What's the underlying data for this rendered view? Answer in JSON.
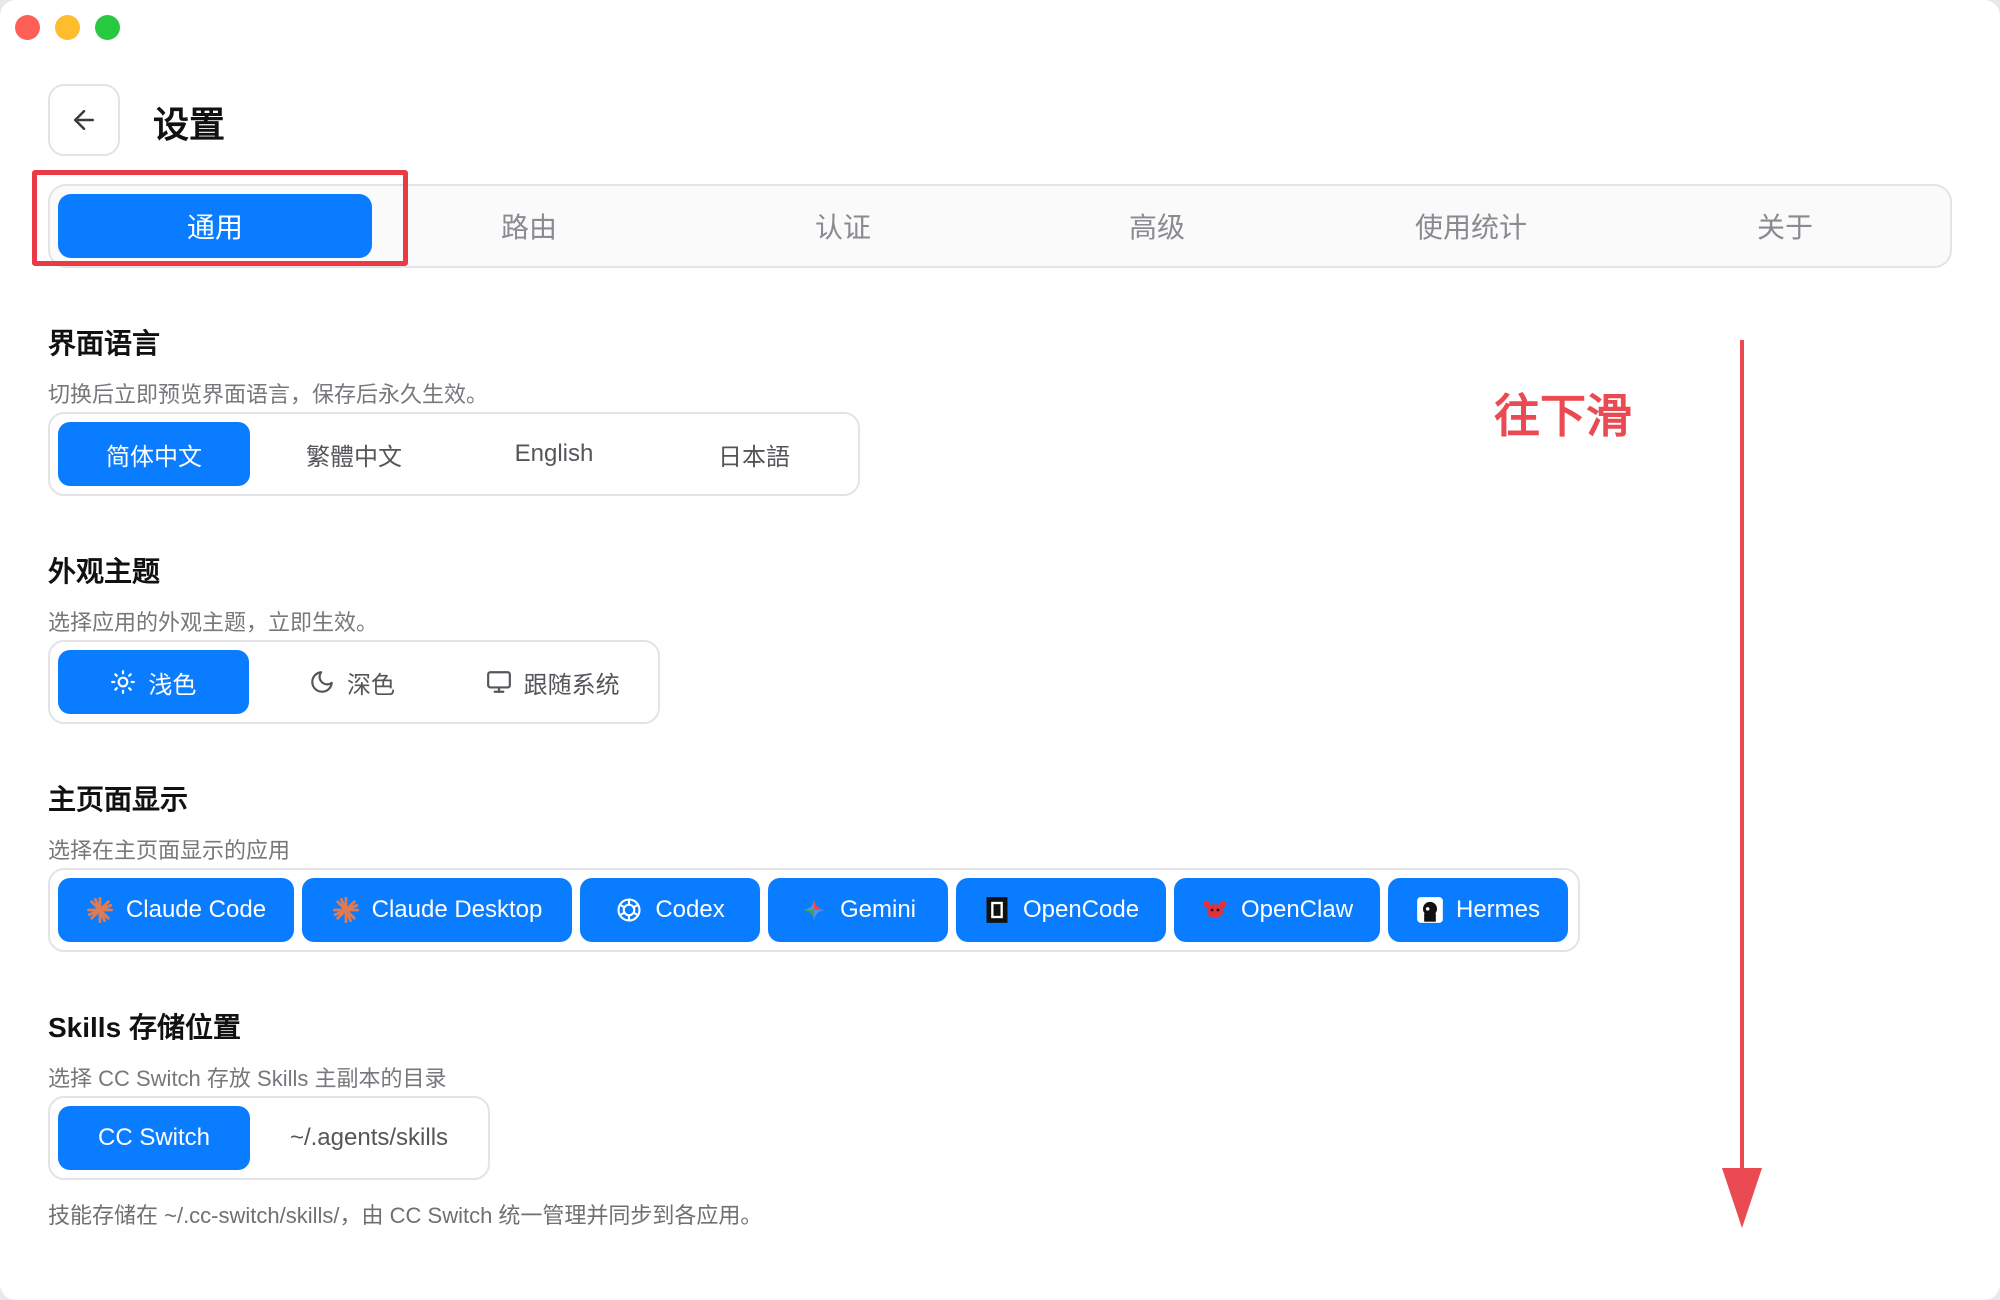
{
  "page": {
    "title": "设置"
  },
  "tabs": [
    {
      "label": "通用",
      "active": true
    },
    {
      "label": "路由",
      "active": false
    },
    {
      "label": "认证",
      "active": false
    },
    {
      "label": "高级",
      "active": false
    },
    {
      "label": "使用统计",
      "active": false
    },
    {
      "label": "关于",
      "active": false
    }
  ],
  "language": {
    "title": "界面语言",
    "desc": "切换后立即预览界面语言，保存后永久生效。",
    "options": [
      "简体中文",
      "繁體中文",
      "English",
      "日本語"
    ],
    "selected": "简体中文"
  },
  "theme": {
    "title": "外观主题",
    "desc": "选择应用的外观主题，立即生效。",
    "options": [
      {
        "label": "浅色",
        "icon": "sun-icon"
      },
      {
        "label": "深色",
        "icon": "moon-icon"
      },
      {
        "label": "跟随系统",
        "icon": "monitor-icon"
      }
    ],
    "selected": "浅色"
  },
  "home_display": {
    "title": "主页面显示",
    "desc": "选择在主页面显示的应用",
    "apps": [
      {
        "label": "Claude Code",
        "icon": "claude-icon"
      },
      {
        "label": "Claude Desktop",
        "icon": "claude-icon"
      },
      {
        "label": "Codex",
        "icon": "openai-icon"
      },
      {
        "label": "Gemini",
        "icon": "gemini-icon"
      },
      {
        "label": "OpenCode",
        "icon": "opencode-icon"
      },
      {
        "label": "OpenClaw",
        "icon": "openclaw-icon"
      },
      {
        "label": "Hermes",
        "icon": "hermes-icon"
      }
    ]
  },
  "skills": {
    "title": "Skills 存储位置",
    "desc": "选择 CC Switch 存放 Skills 主副本的目录",
    "options": [
      "CC Switch",
      "~/.agents/skills"
    ],
    "selected": "CC Switch",
    "note": "技能存储在 ~/.cc-switch/skills/，由 CC Switch 统一管理并同步到各应用。"
  },
  "annotation": {
    "text": "往下滑",
    "color": "#ea4a52"
  },
  "colors": {
    "accent": "#0a7cff",
    "highlight": "#ea3a44"
  }
}
